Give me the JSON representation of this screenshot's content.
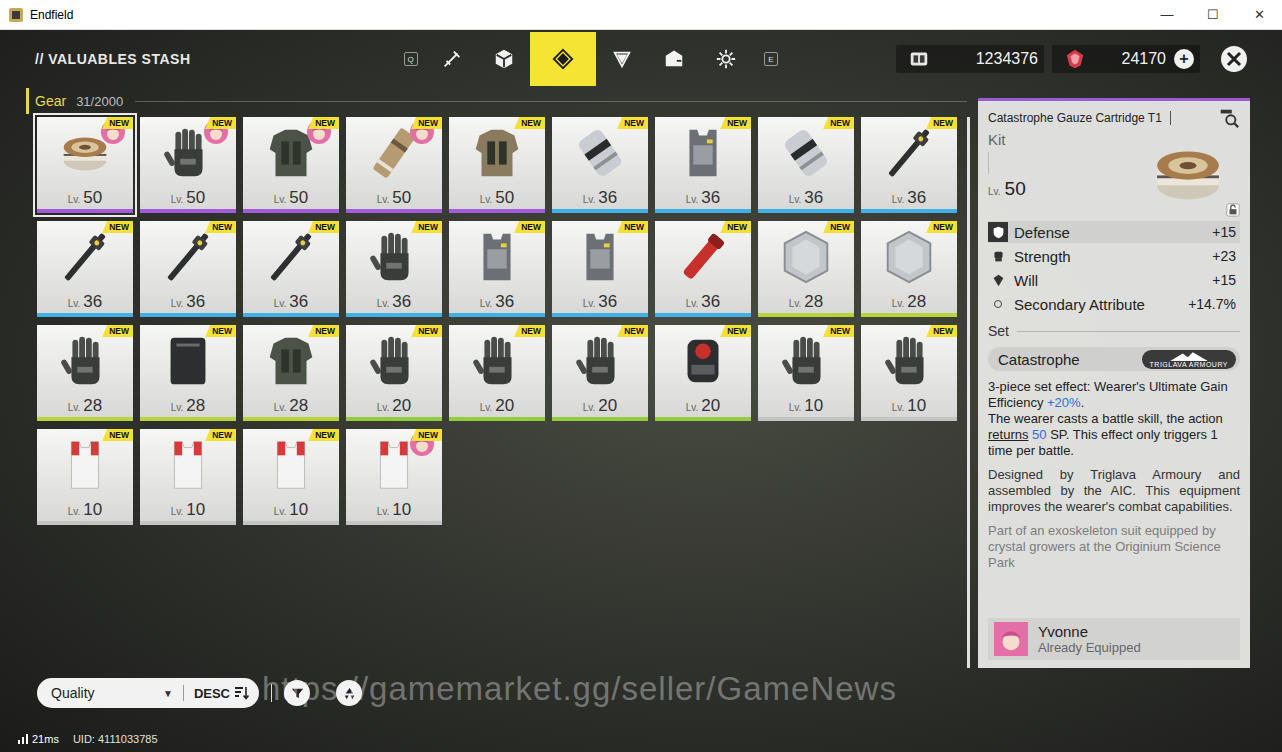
{
  "window": {
    "title": "Endfield",
    "controls": [
      "—",
      "☐",
      "✕"
    ]
  },
  "header": {
    "title": "// VALUABLES STASH",
    "key_left": "Q",
    "key_right": "E",
    "tabs": [
      {
        "kind": "weapon",
        "selected": false
      },
      {
        "kind": "cube",
        "selected": false
      },
      {
        "kind": "gear",
        "selected": true
      },
      {
        "kind": "triangle",
        "selected": false
      },
      {
        "kind": "box",
        "selected": false
      },
      {
        "kind": "cog",
        "selected": false
      }
    ],
    "currencies": [
      {
        "kind": "card",
        "amount": "1234376",
        "plus": ""
      },
      {
        "kind": "gem",
        "amount": "24170",
        "plus": "+"
      }
    ]
  },
  "category": {
    "label": "Gear",
    "count": "31/2000"
  },
  "level_prefix": "Lv.",
  "items": [
    {
      "kind": "kit",
      "level": "50",
      "color": "#a35bd9",
      "badge": "NEW",
      "equipped": true,
      "selected": true
    },
    {
      "kind": "gloves",
      "level": "50",
      "color": "#a35bd9",
      "badge": "NEW",
      "equipped": true,
      "selected": false
    },
    {
      "kind": "armor",
      "level": "50",
      "color": "#a35bd9",
      "badge": "NEW",
      "equipped": true,
      "selected": false
    },
    {
      "kind": "cartridge",
      "level": "50",
      "color": "#a35bd9",
      "badge": "NEW",
      "equipped": true,
      "selected": false
    },
    {
      "kind": "coat",
      "level": "50",
      "color": "#a35bd9",
      "badge": "NEW",
      "equipped": false,
      "selected": false
    },
    {
      "kind": "canister",
      "level": "36",
      "color": "#3fb1e6",
      "badge": "NEW",
      "equipped": false,
      "selected": false
    },
    {
      "kind": "vest",
      "level": "36",
      "color": "#3fb1e6",
      "badge": "NEW",
      "equipped": false,
      "selected": false
    },
    {
      "kind": "canister",
      "level": "36",
      "color": "#3fb1e6",
      "badge": "NEW",
      "equipped": false,
      "selected": false
    },
    {
      "kind": "tool",
      "level": "36",
      "color": "#3fb1e6",
      "badge": "NEW",
      "equipped": false,
      "selected": false
    },
    {
      "kind": "tool",
      "level": "36",
      "color": "#3fb1e6",
      "badge": "NEW",
      "equipped": false,
      "selected": false
    },
    {
      "kind": "tool",
      "level": "36",
      "color": "#3fb1e6",
      "badge": "NEW",
      "equipped": false,
      "selected": false
    },
    {
      "kind": "tool",
      "level": "36",
      "color": "#3fb1e6",
      "badge": "NEW",
      "equipped": false,
      "selected": false
    },
    {
      "kind": "gloves",
      "level": "36",
      "color": "#3fb1e6",
      "badge": "NEW",
      "equipped": false,
      "selected": false
    },
    {
      "kind": "vest",
      "level": "36",
      "color": "#3fb1e6",
      "badge": "NEW",
      "equipped": false,
      "selected": false
    },
    {
      "kind": "vest",
      "level": "36",
      "color": "#3fb1e6",
      "badge": "NEW",
      "equipped": false,
      "selected": false
    },
    {
      "kind": "flashlight",
      "level": "36",
      "color": "#3fb1e6",
      "badge": "NEW",
      "equipped": false,
      "selected": false
    },
    {
      "kind": "plate",
      "level": "28",
      "color": "#b7d43c",
      "badge": "NEW",
      "equipped": false,
      "selected": false
    },
    {
      "kind": "plate",
      "level": "28",
      "color": "#b7d43c",
      "badge": "NEW",
      "equipped": false,
      "selected": false
    },
    {
      "kind": "gloves",
      "level": "28",
      "color": "#b7d43c",
      "badge": "NEW",
      "equipped": false,
      "selected": false
    },
    {
      "kind": "slab",
      "level": "28",
      "color": "#b7d43c",
      "badge": "NEW",
      "equipped": false,
      "selected": false
    },
    {
      "kind": "armor",
      "level": "28",
      "color": "#b7d43c",
      "badge": "NEW",
      "equipped": false,
      "selected": false
    },
    {
      "kind": "gloves",
      "level": "20",
      "color": "#94cc3f",
      "badge": "NEW",
      "equipped": false,
      "selected": false
    },
    {
      "kind": "gloves",
      "level": "20",
      "color": "#94cc3f",
      "badge": "NEW",
      "equipped": false,
      "selected": false
    },
    {
      "kind": "gloves",
      "level": "20",
      "color": "#94cc3f",
      "badge": "NEW",
      "equipped": false,
      "selected": false
    },
    {
      "kind": "device",
      "level": "20",
      "color": "#94cc3f",
      "badge": "NEW",
      "equipped": false,
      "selected": false
    },
    {
      "kind": "gloves",
      "level": "10",
      "color": "#c4c4c4",
      "badge": "NEW",
      "equipped": false,
      "selected": false
    },
    {
      "kind": "gloves",
      "level": "10",
      "color": "#c4c4c4",
      "badge": "NEW",
      "equipped": false,
      "selected": false
    },
    {
      "kind": "racevest",
      "level": "10",
      "color": "#c4c4c4",
      "badge": "NEW",
      "equipped": false,
      "selected": false
    },
    {
      "kind": "racevest",
      "level": "10",
      "color": "#c4c4c4",
      "badge": "NEW",
      "equipped": false,
      "selected": false
    },
    {
      "kind": "racevest",
      "level": "10",
      "color": "#c4c4c4",
      "badge": "NEW",
      "equipped": false,
      "selected": false
    },
    {
      "kind": "racevest",
      "level": "10",
      "color": "#c4c4c4",
      "badge": "NEW",
      "equipped": true,
      "selected": false
    }
  ],
  "detail": {
    "name": "Catastrophe Gauze Cartridge T1",
    "type": "Kit",
    "level": "50",
    "kind": "kit",
    "stats": [
      {
        "label": "Defense",
        "value": "+15",
        "highlighted": true,
        "kind": "shield"
      },
      {
        "label": "Strength",
        "value": "+23",
        "highlighted": false,
        "kind": "fist"
      },
      {
        "label": "Will",
        "value": "+15",
        "highlighted": false,
        "kind": "will"
      }
    ],
    "secondary": {
      "label": "Secondary Attribute",
      "value": "+14.7%"
    },
    "set_label": "Set",
    "set_name": "Catastrophe",
    "set_brand": "TRIGLAVA ARMOURY",
    "set_effect": [
      [
        {
          "text": "3-piece set effect: Wearer's Ultimate Gain Efficiency ",
          "kind": "plain"
        },
        {
          "text": "+20%",
          "kind": "accent"
        },
        {
          "text": ".",
          "kind": "plain"
        }
      ],
      [
        {
          "text": "The wearer casts a battle skill, the action ",
          "kind": "plain"
        },
        {
          "text": "returns",
          "kind": "link"
        },
        {
          "text": " ",
          "kind": "plain"
        },
        {
          "text": "50",
          "kind": "accent"
        },
        {
          "text": " SP. This effect only triggers 1 time per battle.",
          "kind": "plain"
        }
      ]
    ],
    "description": "Designed by Triglava Armoury and assembled by the AIC. This equipment improves the wearer's combat capabilities.",
    "flavor": "Part of an exoskeleton suit equipped by crystal growers at the Originium Science Park",
    "equipped_by": {
      "name": "Yvonne",
      "status": "Already Equipped"
    }
  },
  "sort": {
    "field": "Quality",
    "caret": "▼",
    "order": "DESC"
  },
  "watermark": "https://gamemarket.gg/seller/GameNews",
  "status": {
    "ping": "21ms",
    "uid": "UID: 4111033785"
  }
}
